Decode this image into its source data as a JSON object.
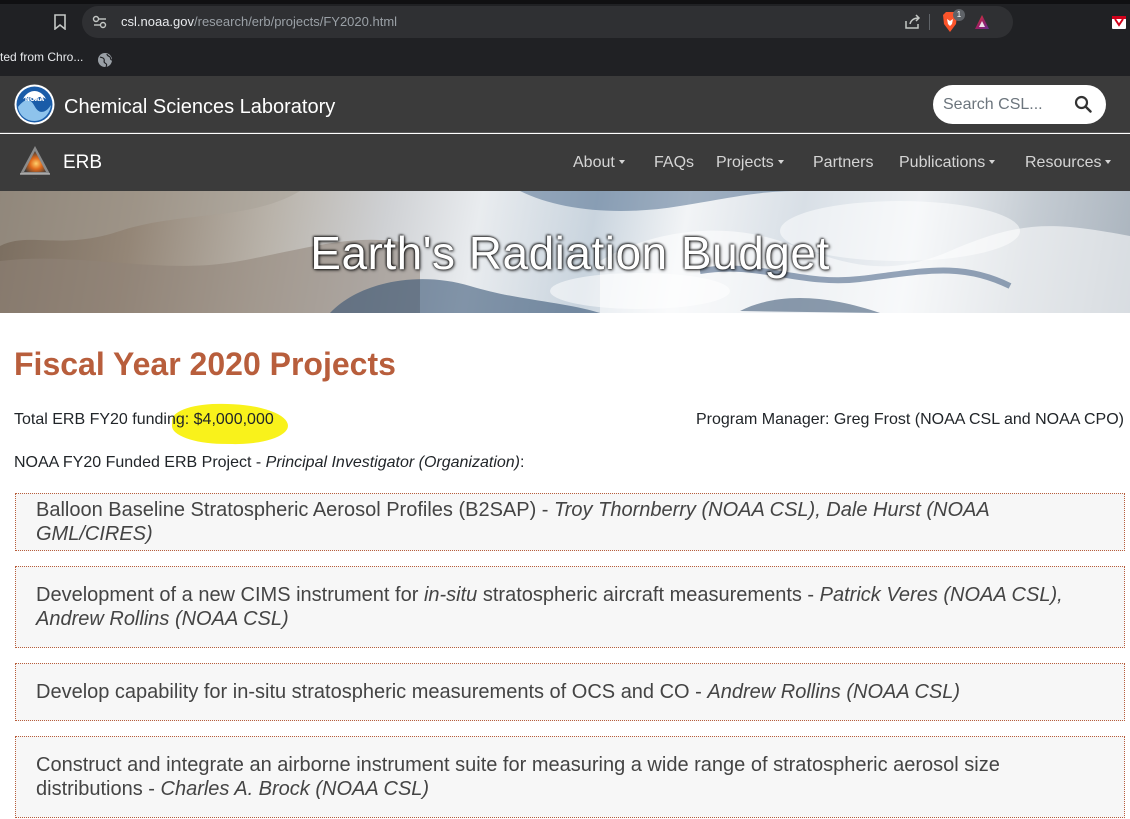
{
  "browser": {
    "url_host": "csl.noaa.gov",
    "url_path": "/research/erb/projects/FY2020.html",
    "brave_badge": "1",
    "bookmark_item": "ted from Chro..."
  },
  "header": {
    "site_title": "Chemical Sciences Laboratory",
    "search_placeholder": "Search CSL...",
    "sub_title": "ERB"
  },
  "nav": {
    "items": [
      {
        "label": "About",
        "dropdown": true
      },
      {
        "label": "FAQs",
        "dropdown": false
      },
      {
        "label": "Projects",
        "dropdown": true
      },
      {
        "label": "Partners",
        "dropdown": false
      },
      {
        "label": "Publications",
        "dropdown": true
      },
      {
        "label": "Resources",
        "dropdown": true
      }
    ]
  },
  "banner": {
    "title": "Earth's Radiation Budget"
  },
  "main": {
    "title": "Fiscal Year 2020 Projects",
    "funding_label": "Total ERB FY20 funding: ",
    "funding_value": "$4,000,000",
    "manager": "Program Manager: Greg Frost (NOAA CSL and NOAA CPO)",
    "legend_prefix": "NOAA FY20 Funded ERB Project - ",
    "legend_italic": "Principal Investigator (Organization)",
    "legend_suffix": ":",
    "projects": [
      {
        "title": "Balloon Baseline Stratospheric Aerosol Profiles (B2SAP) - ",
        "pis": "Troy Thornberry (NOAA CSL), Dale Hurst (NOAA GML/CIRES)"
      },
      {
        "title_a": "Development of a new CIMS instrument for ",
        "title_em": "in-situ",
        "title_b": " stratospheric aircraft measurements - ",
        "pis": "Patrick Veres (NOAA CSL), Andrew Rollins (NOAA CSL)"
      },
      {
        "title": "Develop capability for in-situ stratospheric measurements of OCS and CO - ",
        "pis": "Andrew Rollins (NOAA CSL)"
      },
      {
        "title": "Construct and integrate an airborne instrument suite for measuring a wide range of stratospheric aerosol size distributions - ",
        "pis": "Charles A. Brock (NOAA CSL)"
      }
    ]
  },
  "colors": {
    "accent": "#b85e3c",
    "header_bg": "#3b3b3b",
    "highlight": "#f9f21b"
  }
}
